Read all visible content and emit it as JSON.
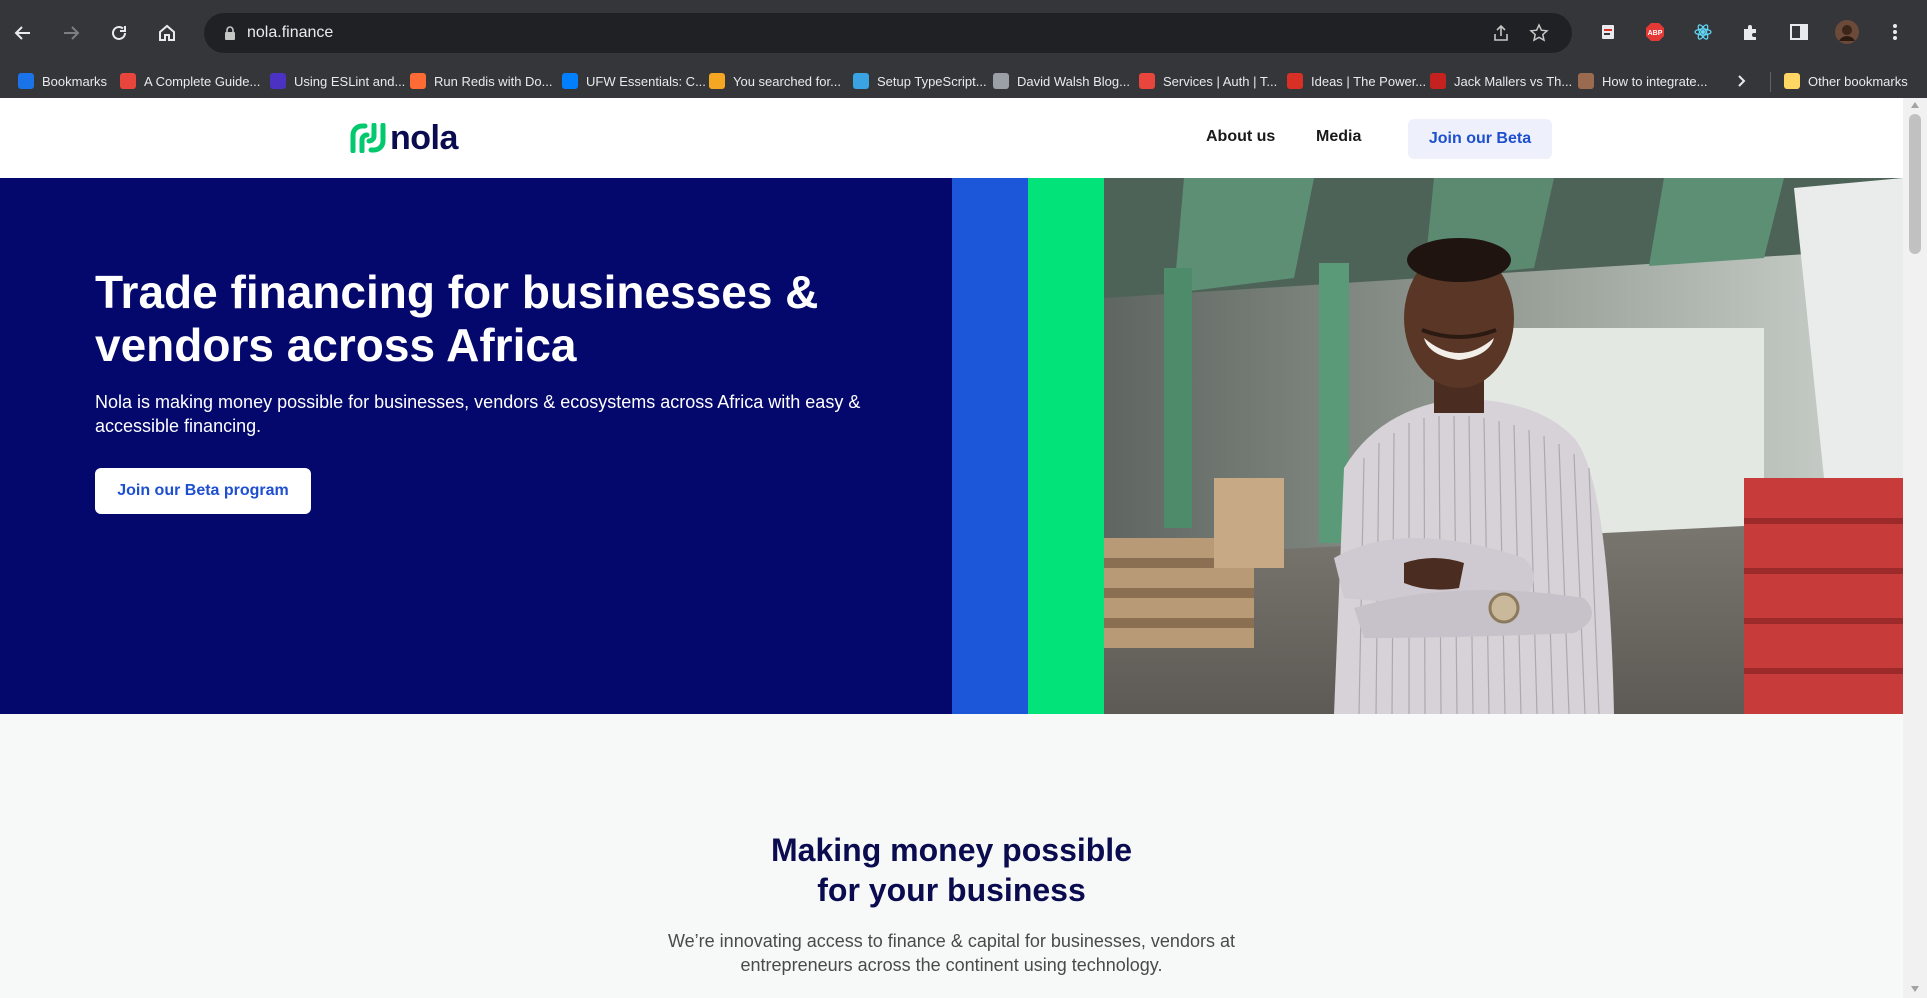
{
  "browser": {
    "url": "nola.finance",
    "bookmarks": [
      {
        "label": "Bookmarks",
        "color": "#1a73e8"
      },
      {
        "label": "A Complete Guide...",
        "color": "#e8453c"
      },
      {
        "label": "Using ESLint and...",
        "color": "#4b32c3"
      },
      {
        "label": "Run Redis with Do...",
        "color": "#ff6b35"
      },
      {
        "label": "UFW Essentials: C...",
        "color": "#0080ff"
      },
      {
        "label": "You searched for...",
        "color": "#f5a623"
      },
      {
        "label": "Setup TypeScript...",
        "color": "#3aa3e3"
      },
      {
        "label": "David Walsh Blog...",
        "color": "#9aa0a6"
      },
      {
        "label": "Services | Auth | T...",
        "color": "#e8453c"
      },
      {
        "label": "Ideas | The Power...",
        "color": "#d93025"
      },
      {
        "label": "Jack Mallers vs Th...",
        "color": "#c5221f"
      },
      {
        "label": "How to integrate...",
        "color": "#9a6b4f"
      }
    ],
    "other_bookmarks": "Other bookmarks"
  },
  "site": {
    "logo_text": "nola",
    "nav": {
      "about": "About us",
      "media": "Media",
      "beta": "Join our Beta"
    },
    "hero": {
      "title": "Trade financing for businesses & vendors across Africa",
      "subtitle": "Nola is making money possible for businesses, vendors & ecosystems across Africa with easy & accessible financing.",
      "cta": "Join our Beta program"
    },
    "section": {
      "title_line1": "Making money possible",
      "title_line2": "for your business",
      "sub_line1": "We’re innovating access to finance & capital for businesses, vendors at",
      "sub_line2": "entrepreneurs across the continent using technology."
    }
  },
  "colors": {
    "navy": "#04086c",
    "blue": "#1b57d8",
    "green": "#02e47a",
    "accent": "#1d4fcf"
  }
}
